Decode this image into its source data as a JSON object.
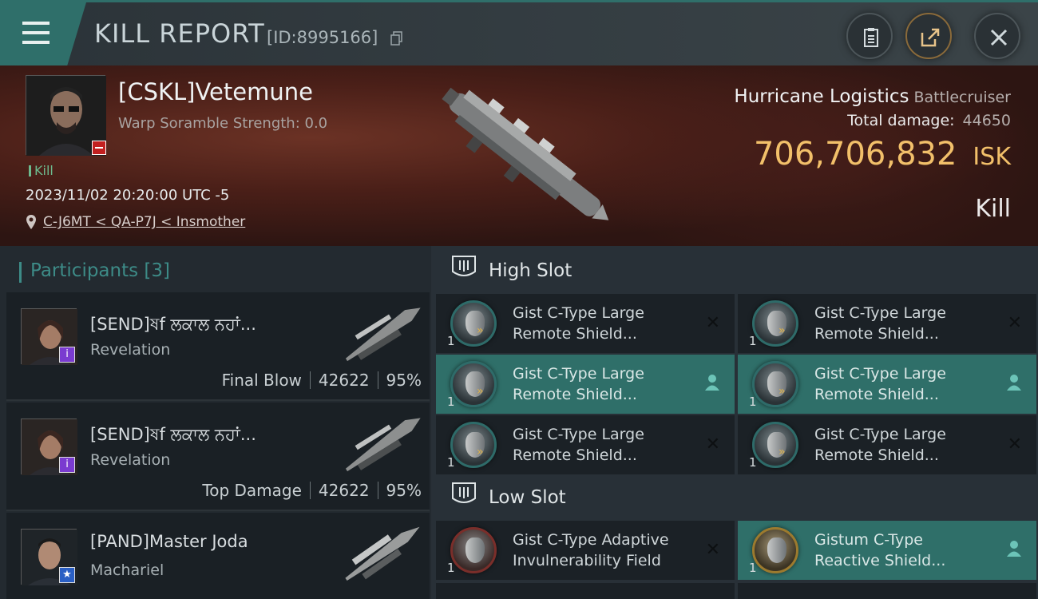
{
  "header": {
    "title": "KILL REPORT",
    "report_id": "[ID:8995166]"
  },
  "victim": {
    "name": "[CSKL]Vetemune",
    "scramble": "Warp Soramble Strength: 0.0",
    "tag": "Kill",
    "datetime": "2023/11/02 20:20:00 UTC -5",
    "location": "C-J6MT < QA-P7J < Insmother",
    "ship": "Hurricane Logistics",
    "ship_class": "Battlecruiser",
    "total_damage_label": "Total damage:",
    "total_damage": "44650",
    "isk_value": "706,706,832",
    "isk_unit": "ISK",
    "result": "Kill"
  },
  "participants": {
    "label": "Participants",
    "count": "[3]",
    "items": [
      {
        "name": "[SEND]ষf ਲਕਾਲ ਨਹਾਂ...",
        "ship": "Revelation",
        "role": "Final Blow",
        "damage": "42622",
        "pct": "95%",
        "badge": "i"
      },
      {
        "name": "[SEND]ষf ਲਕਾਲ ਨਹਾਂ...",
        "ship": "Revelation",
        "role": "Top Damage",
        "damage": "42622",
        "pct": "95%",
        "badge": "i"
      },
      {
        "name": "[PAND]Master Joda",
        "ship": "Machariel",
        "role": "",
        "damage": "",
        "pct": "",
        "badge": "★"
      }
    ]
  },
  "fitting": {
    "high_slot_label": "High Slot",
    "low_slot_label": "Low Slot",
    "high_slot": [
      {
        "qty": "1",
        "line1": "Gist C-Type Large",
        "line2": "Remote Shield...",
        "status": "destroyed"
      },
      {
        "qty": "1",
        "line1": "Gist C-Type Large",
        "line2": "Remote Shield...",
        "status": "destroyed"
      },
      {
        "qty": "1",
        "line1": "Gist C-Type Large",
        "line2": "Remote Shield...",
        "status": "dropped"
      },
      {
        "qty": "1",
        "line1": "Gist C-Type Large",
        "line2": "Remote Shield...",
        "status": "dropped"
      },
      {
        "qty": "1",
        "line1": "Gist C-Type Large",
        "line2": "Remote Shield...",
        "status": "destroyed"
      },
      {
        "qty": "1",
        "line1": "Gist C-Type Large",
        "line2": "Remote Shield...",
        "status": "destroyed"
      }
    ],
    "low_slot": [
      {
        "qty": "1",
        "line1": "Gist C-Type Adaptive",
        "line2": "Invulnerability Field",
        "status": "destroyed"
      },
      {
        "qty": "1",
        "line1": "Gistum C-Type",
        "line2": "Reactive Shield...",
        "status": "dropped"
      }
    ]
  },
  "icons": {
    "menu": "menu-icon",
    "copy": "copy-icon",
    "clipboard": "clipboard-icon",
    "share": "share-icon",
    "close": "close-icon",
    "location": "location-pin-icon",
    "slot": "high-slot-icon",
    "destroyed": "cross-icon",
    "dropped": "person-icon"
  },
  "colors": {
    "accent": "#2f6f6a",
    "isk": "#f2c06a",
    "kill_tag": "#6dba8e"
  }
}
